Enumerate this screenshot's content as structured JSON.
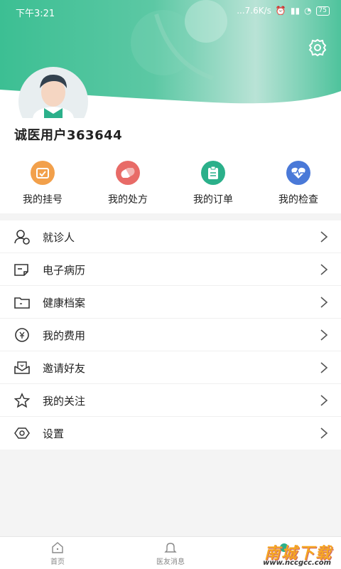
{
  "status_bar": {
    "time": "下午3:21",
    "network": "...7.6K/s",
    "battery": "75"
  },
  "profile": {
    "username": "诚医用户363644"
  },
  "quick_actions": [
    {
      "label": "我的挂号",
      "icon": "calendar-check-icon",
      "color": "#f2a04b"
    },
    {
      "label": "我的处方",
      "icon": "pill-icon",
      "color": "#e86b67"
    },
    {
      "label": "我的订单",
      "icon": "clipboard-icon",
      "color": "#2bb08a"
    },
    {
      "label": "我的检查",
      "icon": "heartbeat-icon",
      "color": "#4a79d8"
    }
  ],
  "menu": [
    {
      "label": "就诊人",
      "icon": "patient-icon"
    },
    {
      "label": "电子病历",
      "icon": "medical-record-icon"
    },
    {
      "label": "健康档案",
      "icon": "folder-icon"
    },
    {
      "label": "我的费用",
      "icon": "yuan-coin-icon"
    },
    {
      "label": "邀请好友",
      "icon": "invite-envelope-icon"
    },
    {
      "label": "我的关注",
      "icon": "star-icon"
    },
    {
      "label": "设置",
      "icon": "hexagon-settings-icon"
    }
  ],
  "bottom_nav": [
    {
      "label": "首页",
      "icon": "home-icon"
    },
    {
      "label": "医友消息",
      "icon": "bell-icon"
    }
  ],
  "watermark": {
    "main": "南城下载",
    "sub": "www.nccgcc.com"
  },
  "colors": {
    "brand_green": "#2bb08a",
    "hero_green": "#3dbf95"
  }
}
